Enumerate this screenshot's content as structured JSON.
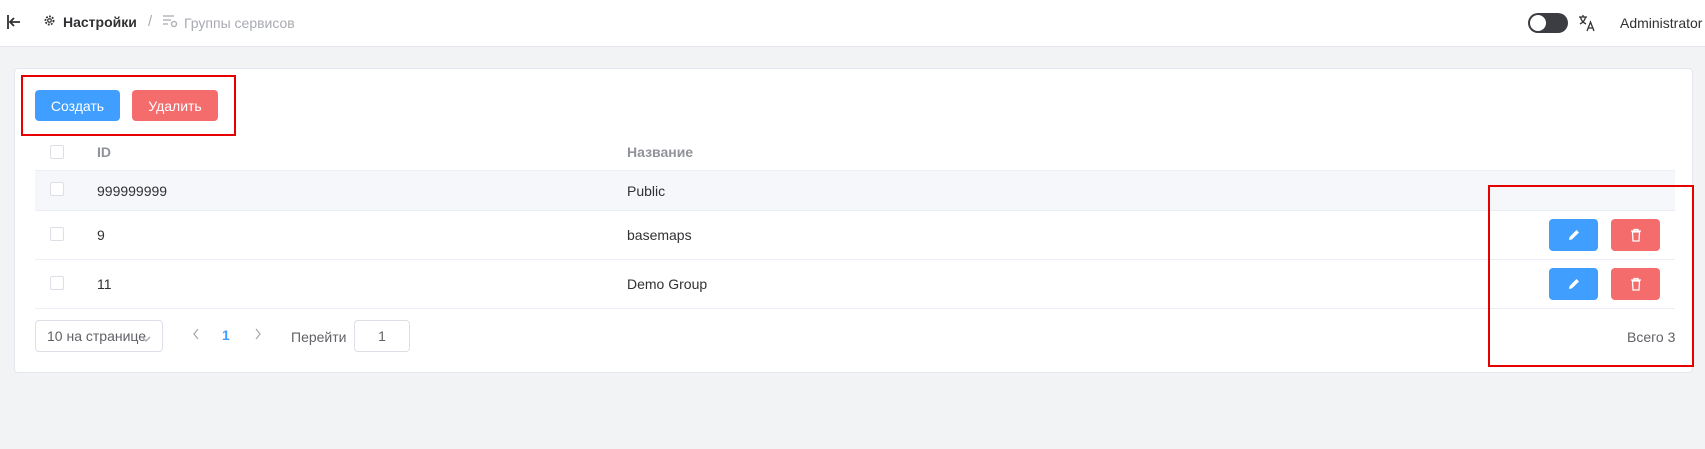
{
  "header": {
    "breadcrumb": [
      "Настройки",
      "Группы сервисов"
    ],
    "separator": "/",
    "user": "Administrator"
  },
  "toolbar": {
    "create_label": "Создать",
    "delete_label": "Удалить"
  },
  "table": {
    "columns": [
      "ID",
      "Название"
    ],
    "rows": [
      {
        "id": "999999999",
        "name": "Public"
      },
      {
        "id": "9",
        "name": "basemaps"
      },
      {
        "id": "11",
        "name": "Demo Group"
      }
    ]
  },
  "pagination": {
    "page_size_label": "10 на странице",
    "current_page": "1",
    "goto_label": "Перейти",
    "goto_value": "1",
    "total_label": "Всего 3"
  },
  "colors": {
    "primary": "#409eff",
    "danger": "#f56c6c",
    "highlight": "#e60000"
  },
  "icons": [
    "back-icon",
    "settings-gear-icon",
    "list-settings-icon",
    "moon-icon",
    "translate-icon",
    "edit-pencil-icon",
    "trash-icon",
    "chevron-down-icon",
    "chevron-left-icon",
    "chevron-right-icon"
  ]
}
